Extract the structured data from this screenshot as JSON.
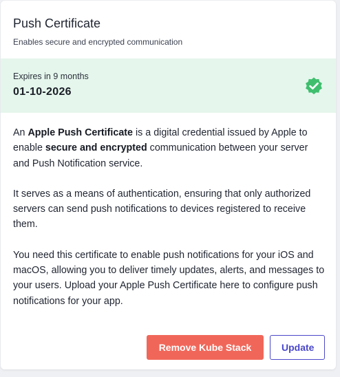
{
  "card": {
    "title": "Push Certificate",
    "subtitle": "Enables secure and encrypted communication"
  },
  "expiry": {
    "label": "Expires in 9 months",
    "date": "01-10-2026",
    "status_icon": "verified-badge-icon",
    "status_color": "#3fbf6e",
    "background": "#e5f6ec"
  },
  "description": {
    "p1_a": "An ",
    "p1_b": "Apple Push Certificate",
    "p1_c": " is a digital credential issued by Apple to enable ",
    "p1_d": "secure and encrypted",
    "p1_e": " communication between your server and Push Notification service.",
    "p2": "It serves as a means of authentication, ensuring that only authorized servers can send push notifications to devices registered to receive them.",
    "p3": "You need this certificate to enable push notifications for your iOS and macOS, allowing you to deliver timely updates, alerts, and messages to your users. Upload your Apple Push Certificate here to configure push notifications for your app."
  },
  "actions": {
    "remove_label": "Remove Kube Stack",
    "update_label": "Update",
    "remove_color": "#f0675a",
    "update_color": "#4a47c9"
  }
}
